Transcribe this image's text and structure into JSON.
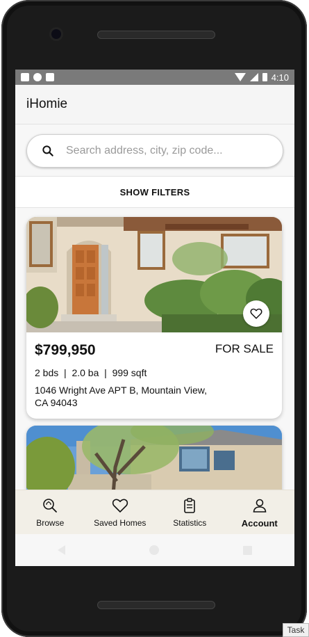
{
  "status_bar": {
    "time": "4:10"
  },
  "app": {
    "title": "iHomie"
  },
  "search": {
    "placeholder": "Search address, city, zip code..."
  },
  "filters": {
    "label": "SHOW FILTERS"
  },
  "listings": [
    {
      "price": "$799,950",
      "status": "FOR SALE",
      "specs": "2 bds  |  2.0 ba  |  999 sqft",
      "address": "1046 Wright Ave APT B, Mountain View, CA 94043"
    }
  ],
  "bottom_nav": [
    {
      "label": "Browse",
      "icon": "search-home-icon"
    },
    {
      "label": "Saved Homes",
      "icon": "heart-icon"
    },
    {
      "label": "Statistics",
      "icon": "clipboard-icon"
    },
    {
      "label": "Account",
      "icon": "person-icon",
      "active": true
    }
  ],
  "system": {
    "task_label": "Task"
  },
  "colors": {
    "bottom_nav_bg": "#f2efe7",
    "status_bar_bg": "#7a7a7a"
  }
}
